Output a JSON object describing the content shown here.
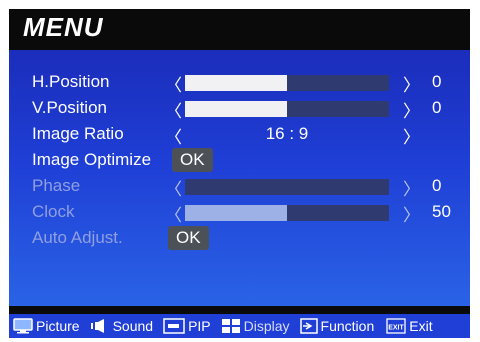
{
  "menu": {
    "title": "MENU"
  },
  "rows": {
    "h_position": {
      "label": "H.Position",
      "left_arrow": "〈",
      "right_arrow": "〉",
      "value": "0",
      "level": 0.5
    },
    "v_position": {
      "label": "V.Position",
      "left_arrow": "〈",
      "right_arrow": "〉",
      "value": "0",
      "level": 0.5
    },
    "image_ratio": {
      "label": "Image Ratio",
      "left_arrow": "〈",
      "right_arrow": "〉",
      "value": "16 : 9"
    },
    "image_optimize": {
      "label": "Image Optimize",
      "button": "OK"
    },
    "phase": {
      "label": "Phase",
      "left_arrow": "〈",
      "right_arrow": "〉",
      "value": "0",
      "level": 0.0,
      "disabled": true
    },
    "clock": {
      "label": "Clock",
      "left_arrow": "〈",
      "right_arrow": "〉",
      "value": "50",
      "level": 0.5,
      "disabled": true
    },
    "auto_adjust": {
      "label": "Auto Adjust.",
      "button": "OK",
      "disabled": true
    }
  },
  "bottom_tabs": [
    {
      "label": "Picture",
      "icon": "monitor-icon"
    },
    {
      "label": "Sound",
      "icon": "speaker-icon"
    },
    {
      "label": "PIP",
      "icon": "pip-icon"
    },
    {
      "label": "Display",
      "icon": "display-grid-icon",
      "active": true
    },
    {
      "label": "Function",
      "icon": "function-icon"
    },
    {
      "label": "Exit",
      "icon": "exit-icon"
    }
  ],
  "colors": {
    "panel": "#1f3fd6",
    "header": "#0a0a0a",
    "slider_fill": "#f1f1f4",
    "slider_track": "#2e3a70",
    "disabled_text": "#8f9fe0",
    "button": "#4c5158"
  }
}
